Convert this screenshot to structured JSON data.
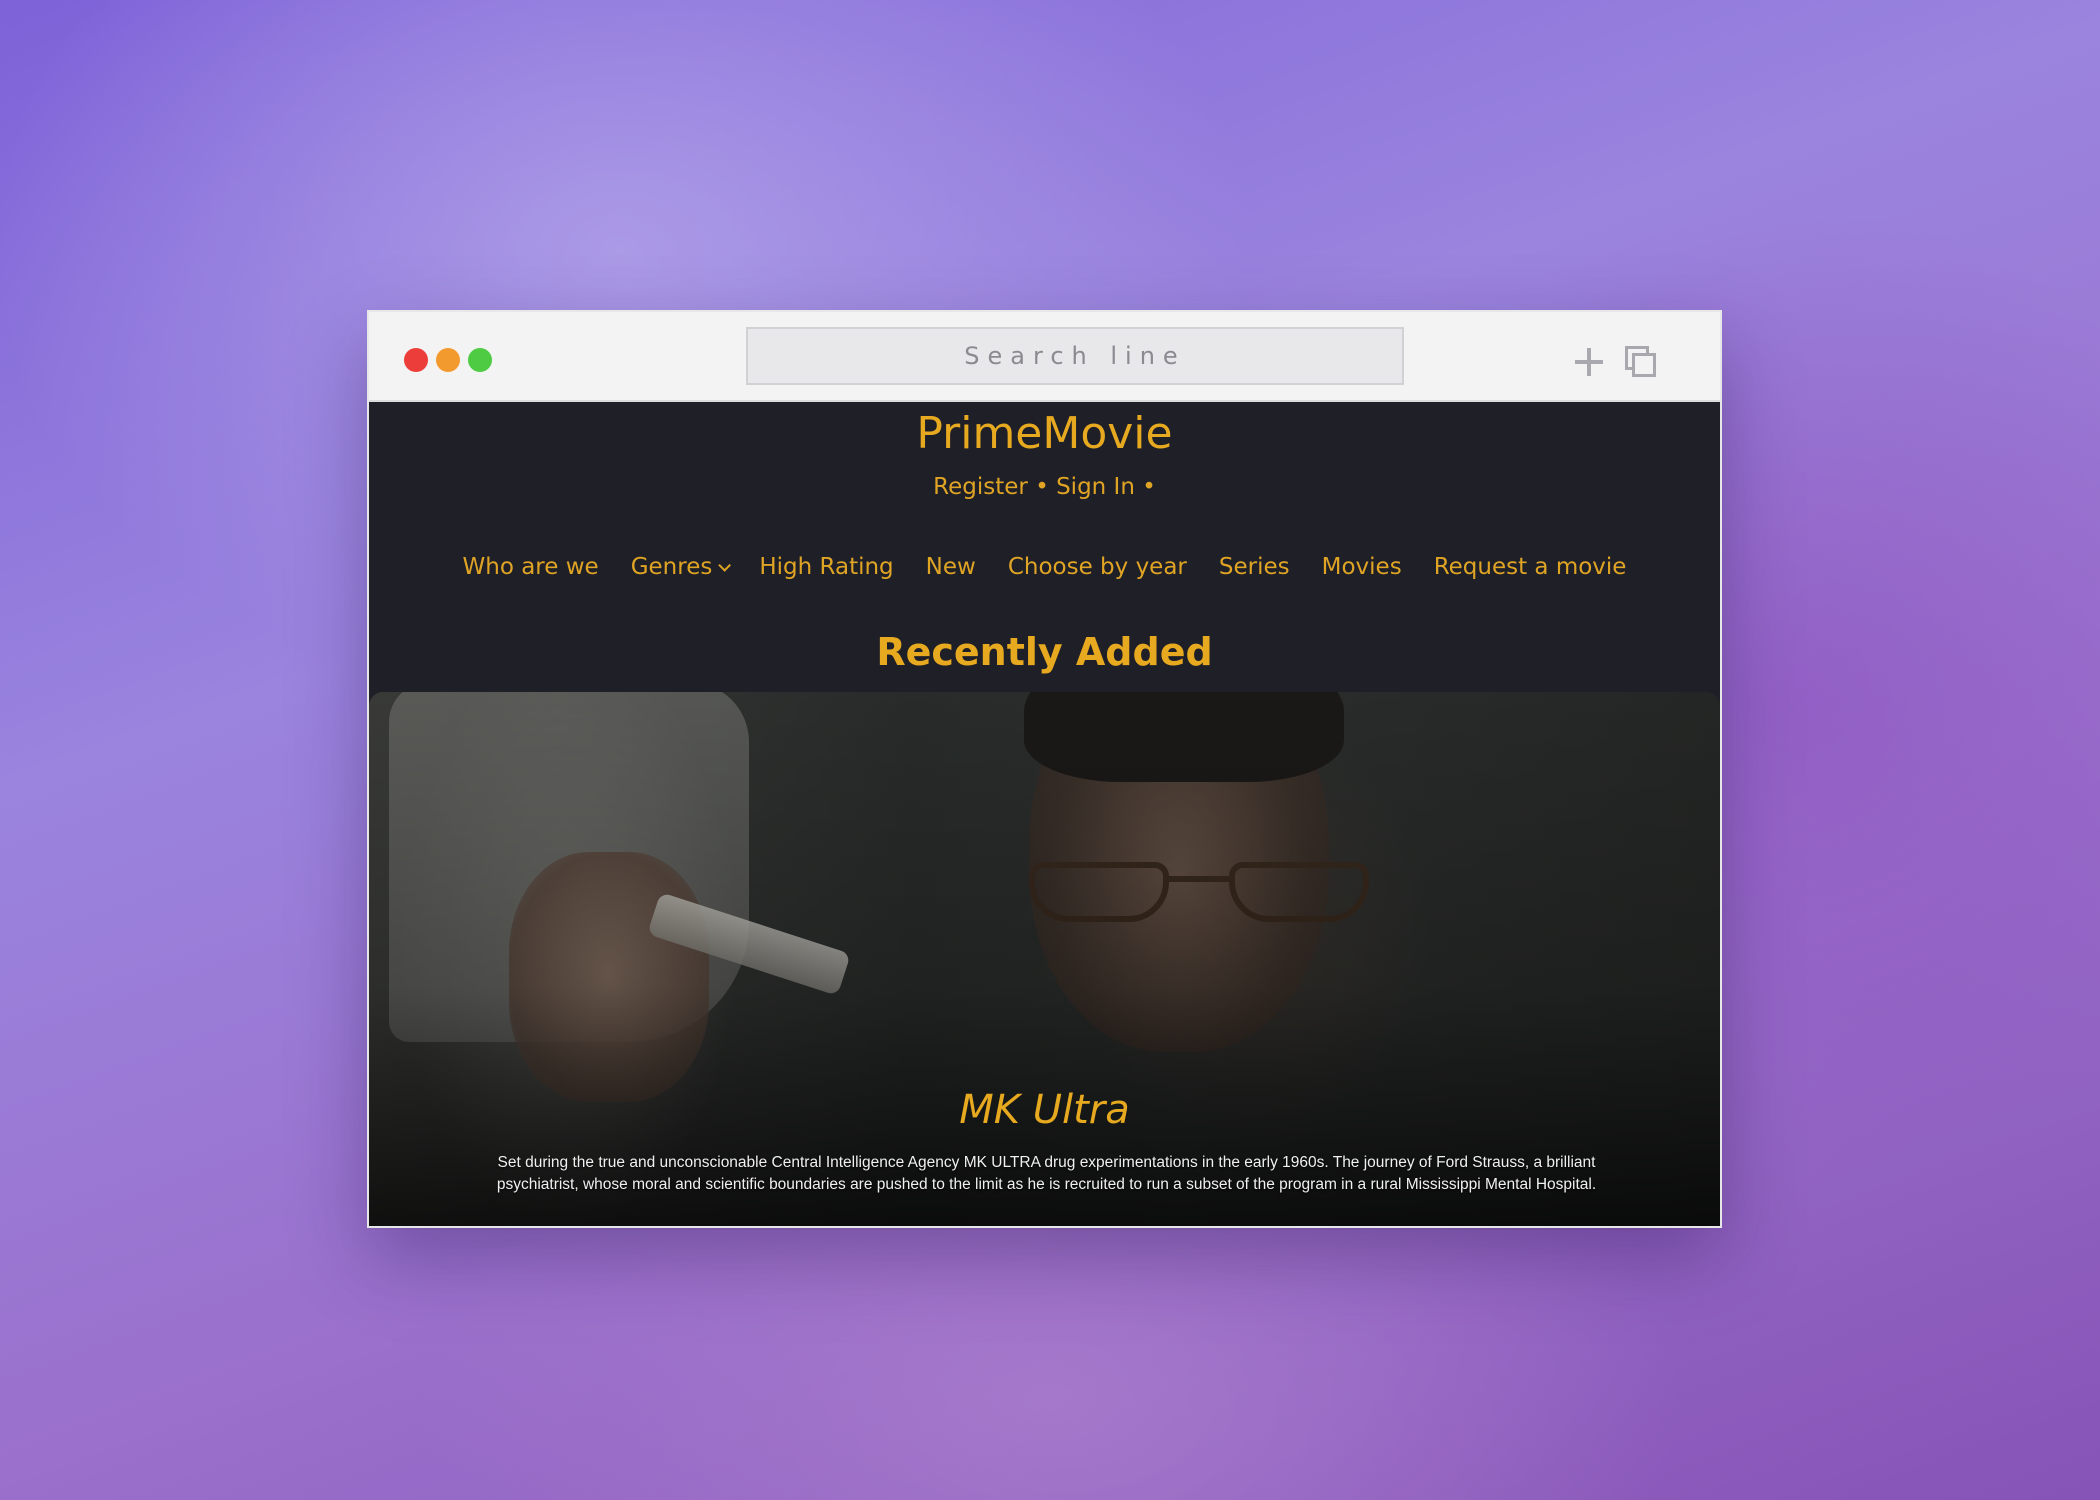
{
  "browser": {
    "search_placeholder": "Search line",
    "colors": {
      "close": "#ec3d3a",
      "minimize": "#f29a2e",
      "maximize": "#4fcb43"
    },
    "icons": [
      "plus-icon",
      "tabs-icon"
    ]
  },
  "site": {
    "logo": "PrimeMovie",
    "auth": {
      "register": "Register",
      "sign_in": "Sign In",
      "separator": "•"
    },
    "nav": [
      {
        "label": "Who are we"
      },
      {
        "label": "Genres",
        "dropdown": true
      },
      {
        "label": "High Rating"
      },
      {
        "label": "New"
      },
      {
        "label": "Choose by year"
      },
      {
        "label": "Series"
      },
      {
        "label": "Movies"
      },
      {
        "label": "Request a movie"
      }
    ],
    "section_title": "Recently Added",
    "accent_color": "#e7a91f",
    "background_color": "#1e1f27"
  },
  "featured": {
    "title": "MK Ultra",
    "description": "Set during the true and unconscionable Central Intelligence Agency MK ULTRA drug experimentations in the early 1960s. The journey of Ford Strauss, a brilliant psychiatrist, whose moral and scientific boundaries are pushed to the limit as he is recruited to run a subset of the program in a rural Mississippi Mental Hospital."
  }
}
